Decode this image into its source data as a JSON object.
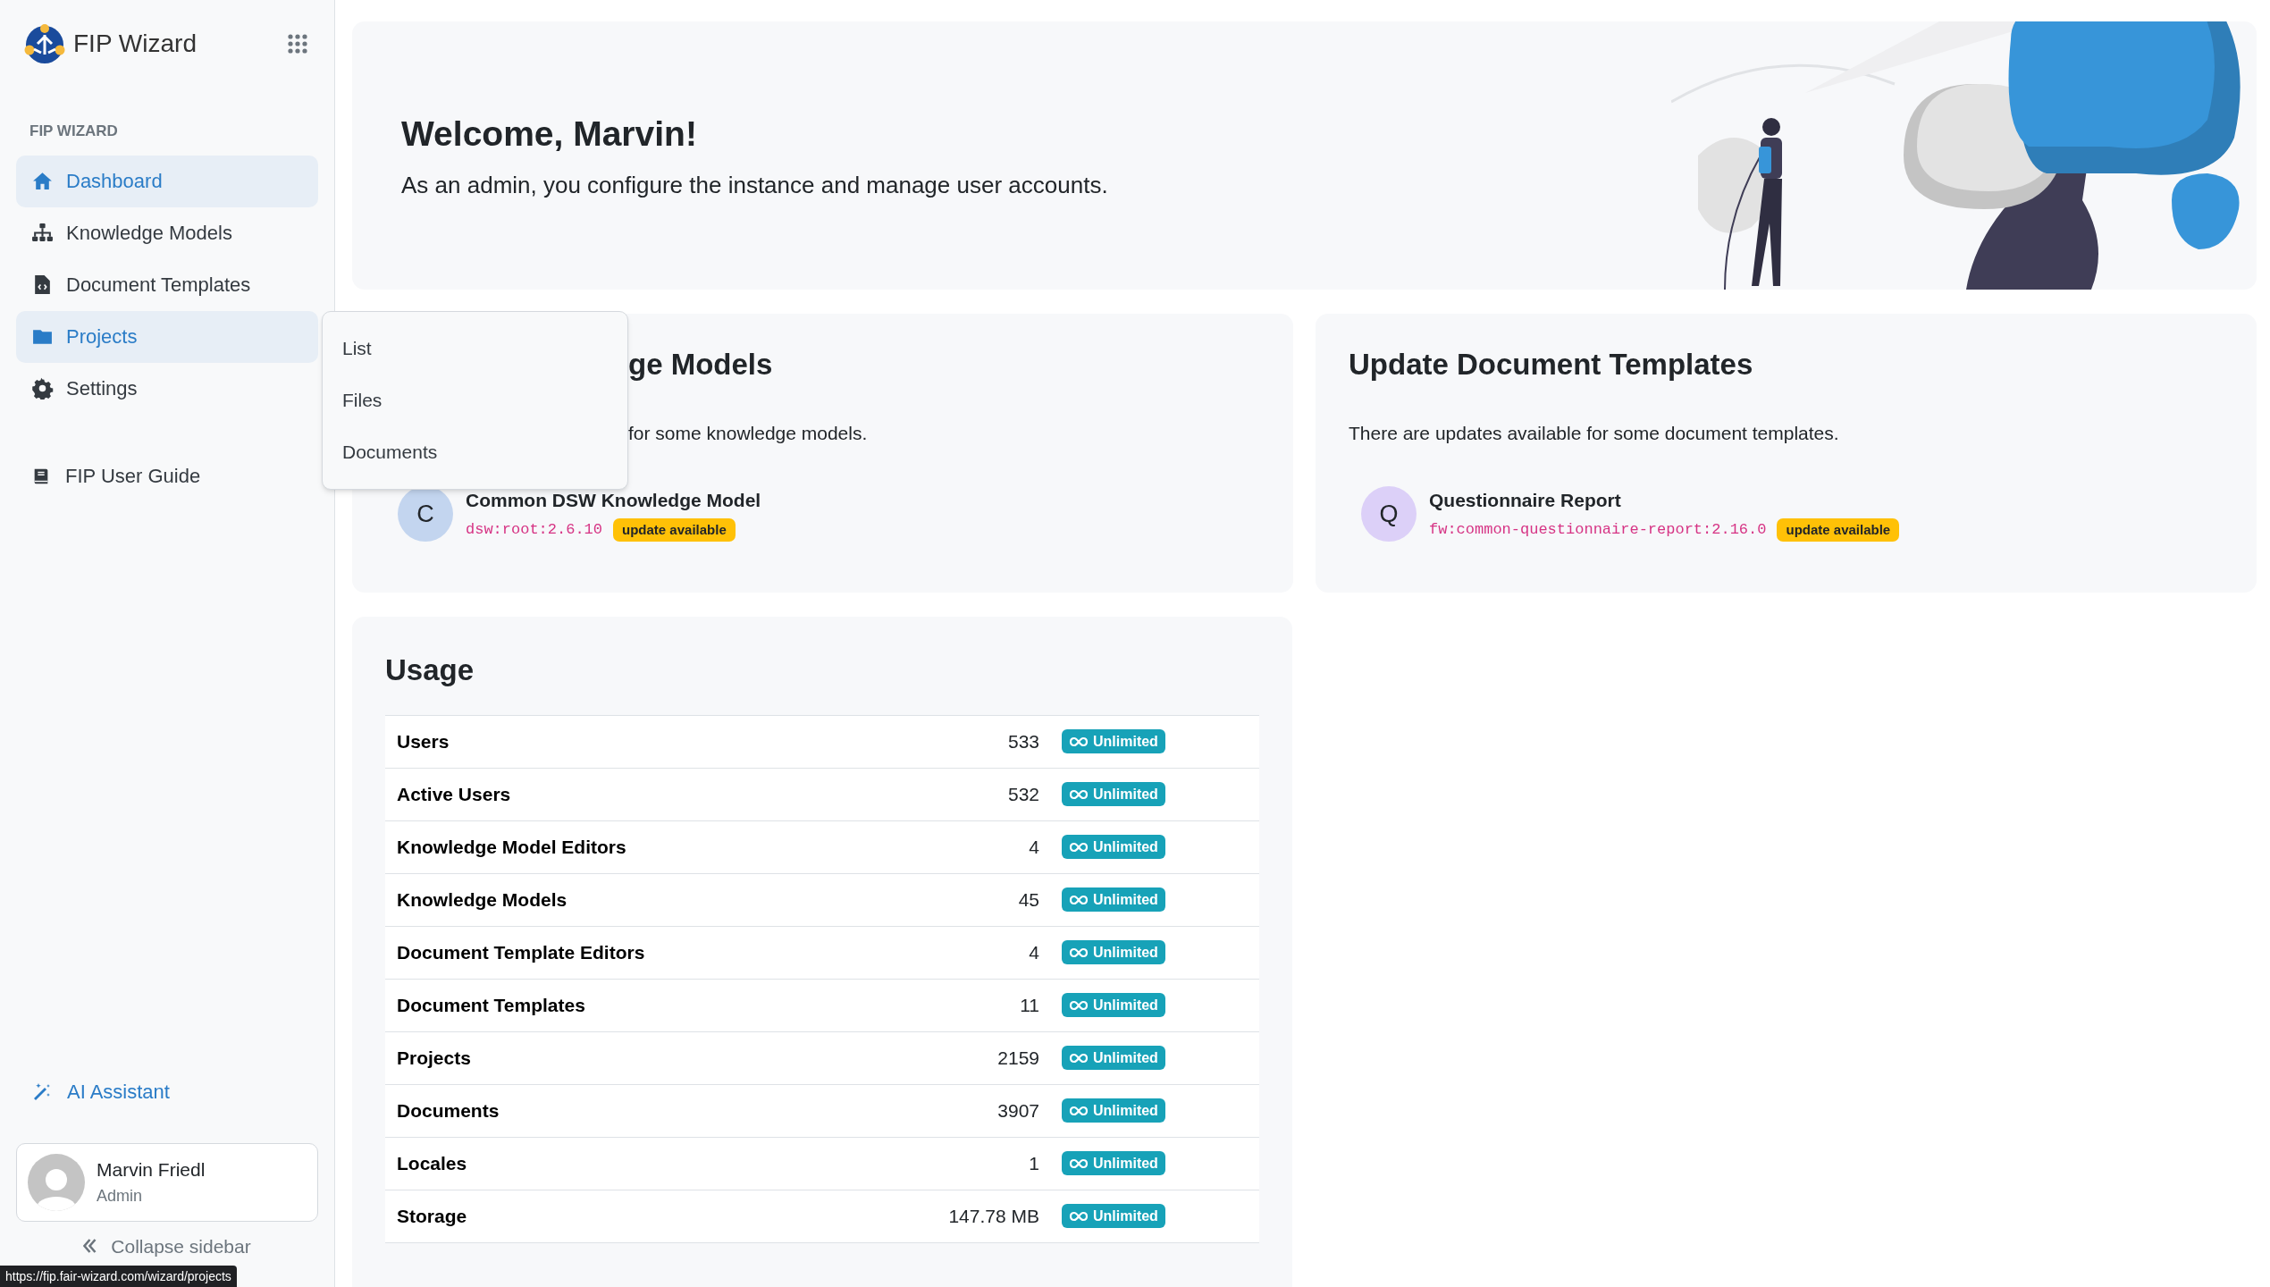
{
  "app": {
    "name": "FIP Wizard"
  },
  "sidebar": {
    "section_label": "FIP WIZARD",
    "items": [
      {
        "label": "Dashboard",
        "selected": true
      },
      {
        "label": "Knowledge Models",
        "selected": false
      },
      {
        "label": "Document Templates",
        "selected": false
      },
      {
        "label": "Projects",
        "selected": true
      },
      {
        "label": "Settings",
        "selected": false
      }
    ],
    "guide": {
      "label": "FIP User Guide"
    },
    "assistant": {
      "label": "AI Assistant"
    },
    "user": {
      "name": "Marvin Friedl",
      "role": "Admin"
    },
    "collapse": {
      "label": "Collapse sidebar"
    }
  },
  "submenu": {
    "items": [
      "List",
      "Files",
      "Documents"
    ]
  },
  "welcome": {
    "title": "Welcome, Marvin!",
    "text": "As an admin, you configure the instance and manage user accounts."
  },
  "update_cards": [
    {
      "title": "ge Models",
      "text": "for some knowledge models.",
      "clipped": true,
      "items": [
        {
          "initial": "C",
          "color": "#c3d5ef",
          "name": "Common DSW Knowledge Model",
          "id": "dsw:root:2.6.10",
          "badge": "update available"
        }
      ]
    },
    {
      "title": "Update Document Templates",
      "text": "There are updates available for some document templates.",
      "clipped": false,
      "items": [
        {
          "initial": "Q",
          "color": "#dcd0f8",
          "name": "Questionnaire Report",
          "id": "fw:common-questionnaire-report:2.16.0",
          "badge": "update available"
        }
      ]
    }
  ],
  "usage": {
    "title": "Usage",
    "rows": [
      {
        "label": "Users",
        "value": "533",
        "limit": "Unlimited"
      },
      {
        "label": "Active Users",
        "value": "532",
        "limit": "Unlimited"
      },
      {
        "label": "Knowledge Model Editors",
        "value": "4",
        "limit": "Unlimited"
      },
      {
        "label": "Knowledge Models",
        "value": "45",
        "limit": "Unlimited"
      },
      {
        "label": "Document Template Editors",
        "value": "4",
        "limit": "Unlimited"
      },
      {
        "label": "Document Templates",
        "value": "11",
        "limit": "Unlimited"
      },
      {
        "label": "Projects",
        "value": "2159",
        "limit": "Unlimited"
      },
      {
        "label": "Documents",
        "value": "3907",
        "limit": "Unlimited"
      },
      {
        "label": "Locales",
        "value": "1",
        "limit": "Unlimited"
      },
      {
        "label": "Storage",
        "value": "147.78 MB",
        "limit": "Unlimited"
      }
    ]
  },
  "status_bar": {
    "url": "https://fip.fair-wizard.com/wizard/projects"
  }
}
